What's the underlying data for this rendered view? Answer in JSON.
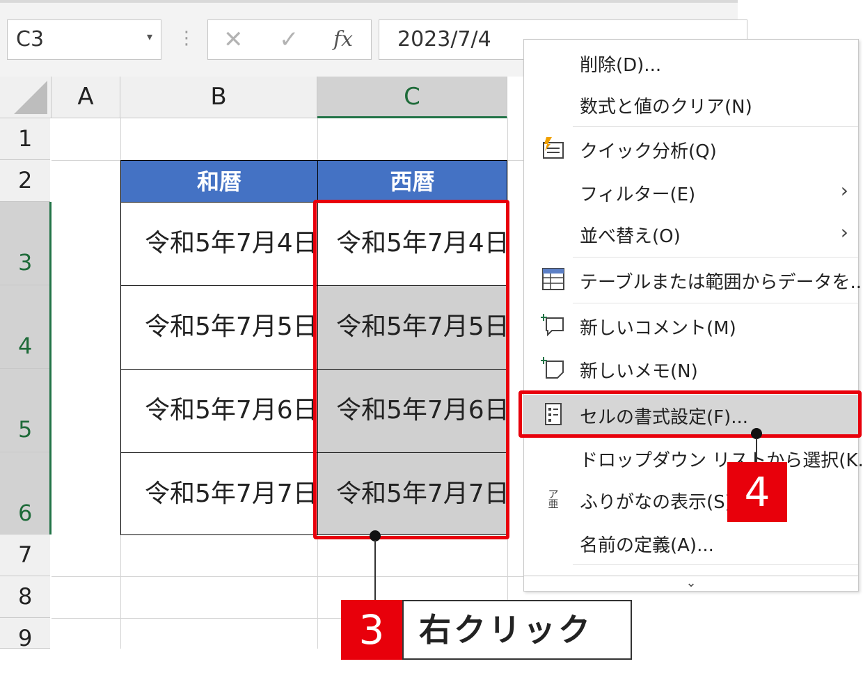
{
  "formula_bar": {
    "name_box": "C3",
    "cancel_icon": "✕",
    "enter_icon": "✓",
    "fx_icon": "fx",
    "formula": "2023/7/4"
  },
  "columns": [
    "A",
    "B",
    "C"
  ],
  "rows": [
    "1",
    "2",
    "3",
    "4",
    "5",
    "6",
    "7",
    "8",
    "9"
  ],
  "table": {
    "headers": [
      "和暦",
      "西暦"
    ],
    "wareki": [
      "令和5年7月4日",
      "令和5年7月5日",
      "令和5年7月6日",
      "令和5年7月7日"
    ],
    "seireki": [
      "令和5年7月4日",
      "令和5年7月5日",
      "令和5年7月6日",
      "令和5年7月7日"
    ]
  },
  "context_menu": {
    "items": [
      {
        "label": "削除(D)...",
        "icon": "",
        "has_submenu": false
      },
      {
        "label": "数式と値のクリア(N)",
        "icon": "",
        "has_submenu": false
      },
      {
        "label": "クイック分析(Q)",
        "icon": "quick-analysis-icon",
        "has_submenu": false
      },
      {
        "label": "フィルター(E)",
        "icon": "",
        "has_submenu": true
      },
      {
        "label": "並べ替え(O)",
        "icon": "",
        "has_submenu": true
      },
      {
        "label": "テーブルまたは範囲からデータを...",
        "icon": "table-icon",
        "has_submenu": false
      },
      {
        "label": "新しいコメント(M)",
        "icon": "new-comment-icon",
        "has_submenu": false
      },
      {
        "label": "新しいメモ(N)",
        "icon": "new-note-icon",
        "has_submenu": false
      },
      {
        "label": "セルの書式設定(F)...",
        "icon": "format-cells-icon",
        "has_submenu": false
      },
      {
        "label": "ドロップダウン リストから選択(K...",
        "icon": "",
        "has_submenu": false
      },
      {
        "label": "ふりがなの表示(S)",
        "icon": "furigana-icon",
        "has_submenu": false
      },
      {
        "label": "名前の定義(A)...",
        "icon": "",
        "has_submenu": false
      }
    ],
    "submenu_glyph": "›",
    "expand_glyph": "⌄",
    "furigana_glyph_top": "ア",
    "furigana_glyph_bottom": "亜"
  },
  "callouts": {
    "step3_number": "3",
    "step3_text": "右クリック",
    "step4_number": "4"
  },
  "colors": {
    "header_blue": "#4472c4",
    "highlight_red": "#e8000b",
    "excel_green": "#217346",
    "selected_gray": "#d0d0d0"
  }
}
